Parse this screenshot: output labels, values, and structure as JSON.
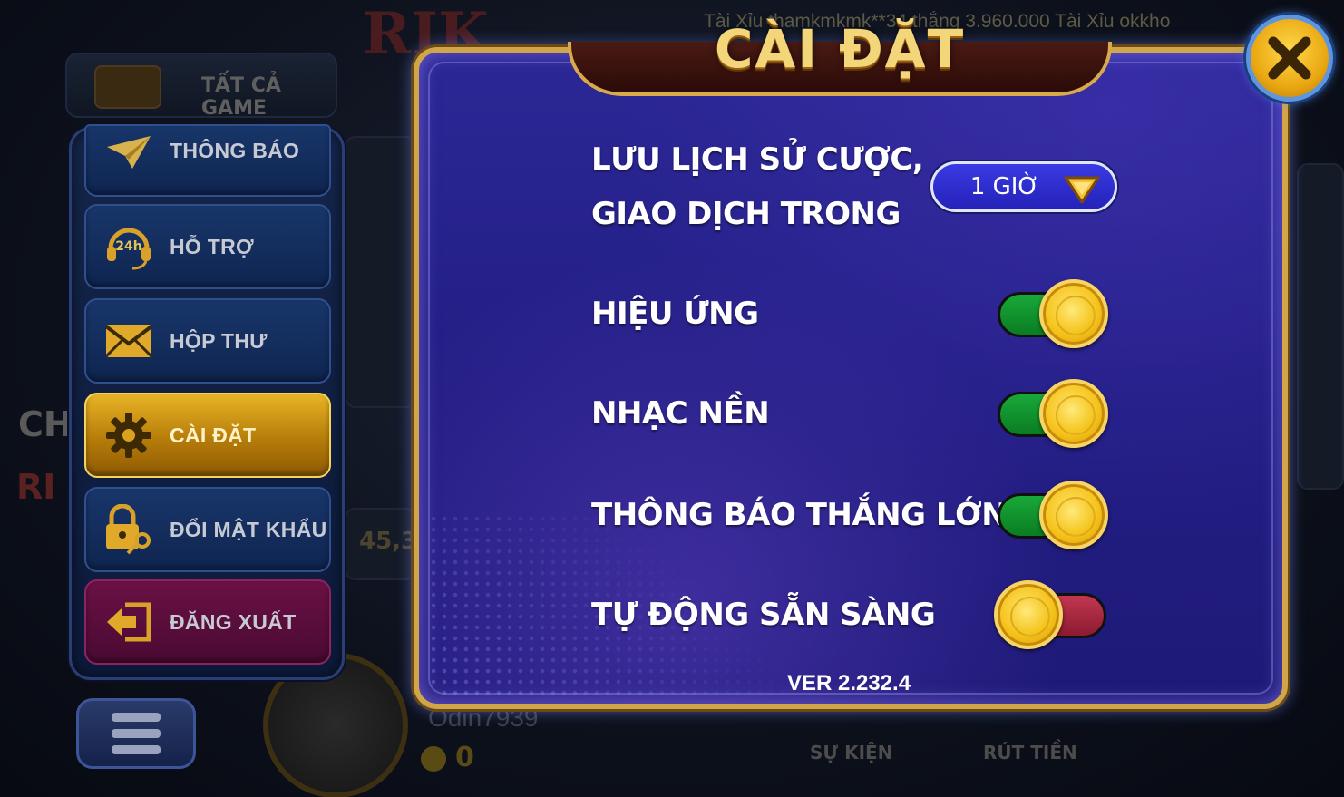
{
  "background": {
    "ticker": "Tài Xỉu thamkmkmk**34 thắng 3.960.000 Tài Xỉu okkho",
    "all_games_label": "TẤT CẢ GAME",
    "side_text_1": "CH",
    "side_text_2": "RI",
    "amount_fragment": "45,3",
    "username": "Odin7939",
    "coin_balance": "0",
    "event_label": "SỰ KIỆN",
    "withdraw_label": "RÚT TIỀN"
  },
  "side_menu": {
    "items": [
      {
        "label": "THÔNG BÁO",
        "icon": "paper-plane-icon"
      },
      {
        "label": "HỖ TRỢ",
        "icon": "headset-24h-icon"
      },
      {
        "label": "HỘP THƯ",
        "icon": "mail-icon"
      },
      {
        "label": "CÀI ĐẶT",
        "icon": "gear-icon",
        "active": true
      },
      {
        "label": "ĐỔI MẬT KHẨU",
        "icon": "lock-key-icon"
      },
      {
        "label": "ĐĂNG XUẤT",
        "icon": "logout-arrow-icon"
      }
    ],
    "headset_badge": "24h"
  },
  "dialog": {
    "title": "CÀI ĐẶT",
    "history_label_line1": "LƯU LỊCH SỬ CƯỢC,",
    "history_label_line2": "GIAO DỊCH TRONG",
    "history_select_value": "1 GIỜ",
    "settings": [
      {
        "label": "HIỆU ỨNG",
        "enabled": true
      },
      {
        "label": "NHẠC NỀN",
        "enabled": true
      },
      {
        "label": "THÔNG BÁO THẮNG LỚN",
        "enabled": true
      },
      {
        "label": "TỰ ĐỘNG SẴN SÀNG",
        "enabled": false
      }
    ],
    "version": "VER 2.232.4"
  },
  "colors": {
    "dialog_bg": "#2b2795",
    "gold_border": "#d1a64a",
    "toggle_on": "#19a83a",
    "toggle_off": "#c23750",
    "active_menu": "#e8b425"
  }
}
